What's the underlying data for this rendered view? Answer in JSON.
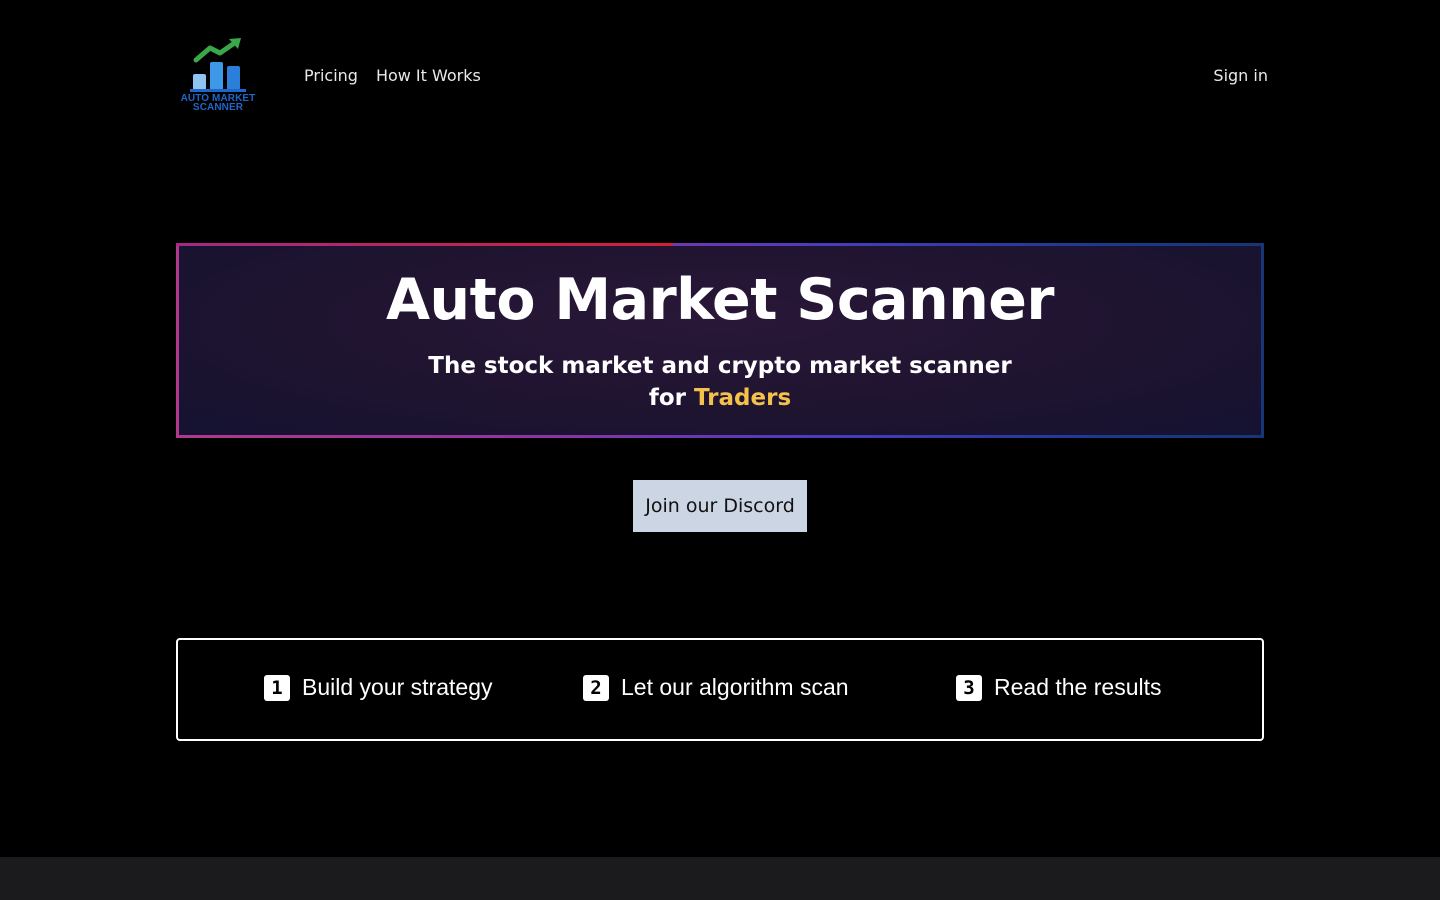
{
  "logo": {
    "line1": "AUTO MARKET",
    "line2": "SCANNER"
  },
  "nav": {
    "items": [
      {
        "label": "Pricing"
      },
      {
        "label": "How It Works"
      }
    ],
    "signin": "Sign in"
  },
  "hero": {
    "title": "Auto Market Scanner",
    "subtitle_line1": "The stock market and crypto market scanner",
    "subtitle_for": "for",
    "subtitle_accent": "Traders"
  },
  "discord_button": "Join our Discord",
  "steps": [
    {
      "num": "1",
      "label": "Build your strategy"
    },
    {
      "num": "2",
      "label": "Let our algorithm scan"
    },
    {
      "num": "3",
      "label": "Read the results"
    }
  ],
  "colors": {
    "accent_yellow": "#f4c14b",
    "logo_blue": "#1f66c9",
    "logo_green": "#3aa84a",
    "button_bg": "#ccd5e3"
  }
}
